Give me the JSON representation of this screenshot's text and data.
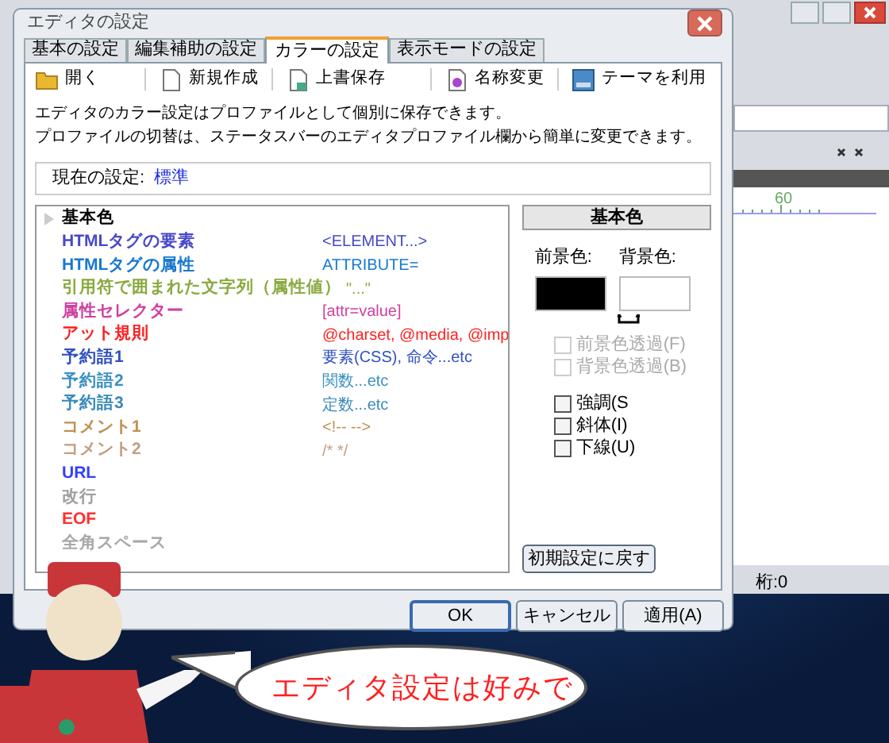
{
  "background_app": {
    "ruler_mark": "60",
    "status_column": "桁:0"
  },
  "dialog": {
    "title": "エディタの設定",
    "tabs": [
      {
        "label": "基本の設定",
        "selected": false
      },
      {
        "label": "編集補助の設定",
        "selected": false
      },
      {
        "label": "カラーの設定",
        "selected": true
      },
      {
        "label": "表示モードの設定",
        "selected": false
      }
    ],
    "toolbar": [
      {
        "label": "開く",
        "kind": "folder"
      },
      {
        "label": "新規作成",
        "kind": "page"
      },
      {
        "label": "上書保存",
        "kind": "save"
      },
      {
        "label": "名称変更",
        "kind": "rename"
      },
      {
        "label": "テーマを利用",
        "kind": "theme"
      }
    ],
    "description": [
      "エディタのカラー設定はプロファイルとして個別に保存できます。",
      "プロファイルの切替は、ステータスバーのエディタプロファイル欄から簡単に変更できます。"
    ],
    "current_setting": {
      "label": "現在の設定:",
      "value": "標準"
    },
    "color_items": [
      {
        "label": "基本色",
        "selected": true,
        "color": "#000000"
      },
      {
        "label": "HTMLタグの要素",
        "sample": "<ELEMENT...>",
        "selected": false,
        "color": "#4848c8"
      },
      {
        "label": "HTMLタグの属性",
        "sample": "ATTRIBUTE=",
        "selected": false,
        "color": "#1878d0"
      },
      {
        "label": "引用符で囲まれた文字列（属性値）",
        "sample": "\"...\"",
        "selected": false,
        "color": "#8aaa40"
      },
      {
        "label": "属性セレクター",
        "sample": "[attr=value]",
        "selected": false,
        "color": "#d040a0"
      },
      {
        "label": "アット規則",
        "sample": "@charset, @media, @imp",
        "selected": false,
        "color": "#ff2020"
      },
      {
        "label": "予約語1",
        "sample": "要素(CSS), 命令...etc",
        "selected": false,
        "color": "#3050c0"
      },
      {
        "label": "予約語2",
        "sample": "関数...etc",
        "selected": false,
        "color": "#3a90c0"
      },
      {
        "label": "予約語3",
        "sample": "定数...etc",
        "selected": false,
        "color": "#3a8ab8"
      },
      {
        "label": "コメント1",
        "sample": "<!-- -->",
        "selected": false,
        "color": "#c09050"
      },
      {
        "label": "コメント2",
        "sample": "/* */",
        "selected": false,
        "color": "#c0a080"
      },
      {
        "label": "URL",
        "selected": false,
        "color": "#3040ff"
      },
      {
        "label": "改行",
        "selected": false,
        "color": "#a0a0a0"
      },
      {
        "label": "EOF",
        "selected": false,
        "color": "#ff3030"
      },
      {
        "label": "全角スペース",
        "selected": false,
        "color": "#a8a8a8"
      }
    ],
    "style_panel": {
      "title": "基本色",
      "foreground": {
        "label": "前景色:",
        "color": "#000000"
      },
      "background": {
        "label": "背景色:",
        "color": "#ffffff"
      },
      "options": [
        {
          "label": "前景色透過(F)",
          "checked": false,
          "disabled": true
        },
        {
          "label": "背景色透過(B)",
          "checked": false,
          "disabled": true
        },
        {
          "label": "強調(S",
          "checked": false,
          "disabled": false
        },
        {
          "label": "斜体(I)",
          "checked": false,
          "disabled": false
        },
        {
          "label": "下線(U)",
          "checked": false,
          "disabled": false
        }
      ],
      "reset_button": "初期設定に戻す"
    },
    "buttons": [
      {
        "label": "OK",
        "default": true
      },
      {
        "label": "キャンセル",
        "default": false
      },
      {
        "label": "適用(A)",
        "default": false
      }
    ]
  },
  "speech_bubble": {
    "text": "エディタ設定は好みで"
  }
}
